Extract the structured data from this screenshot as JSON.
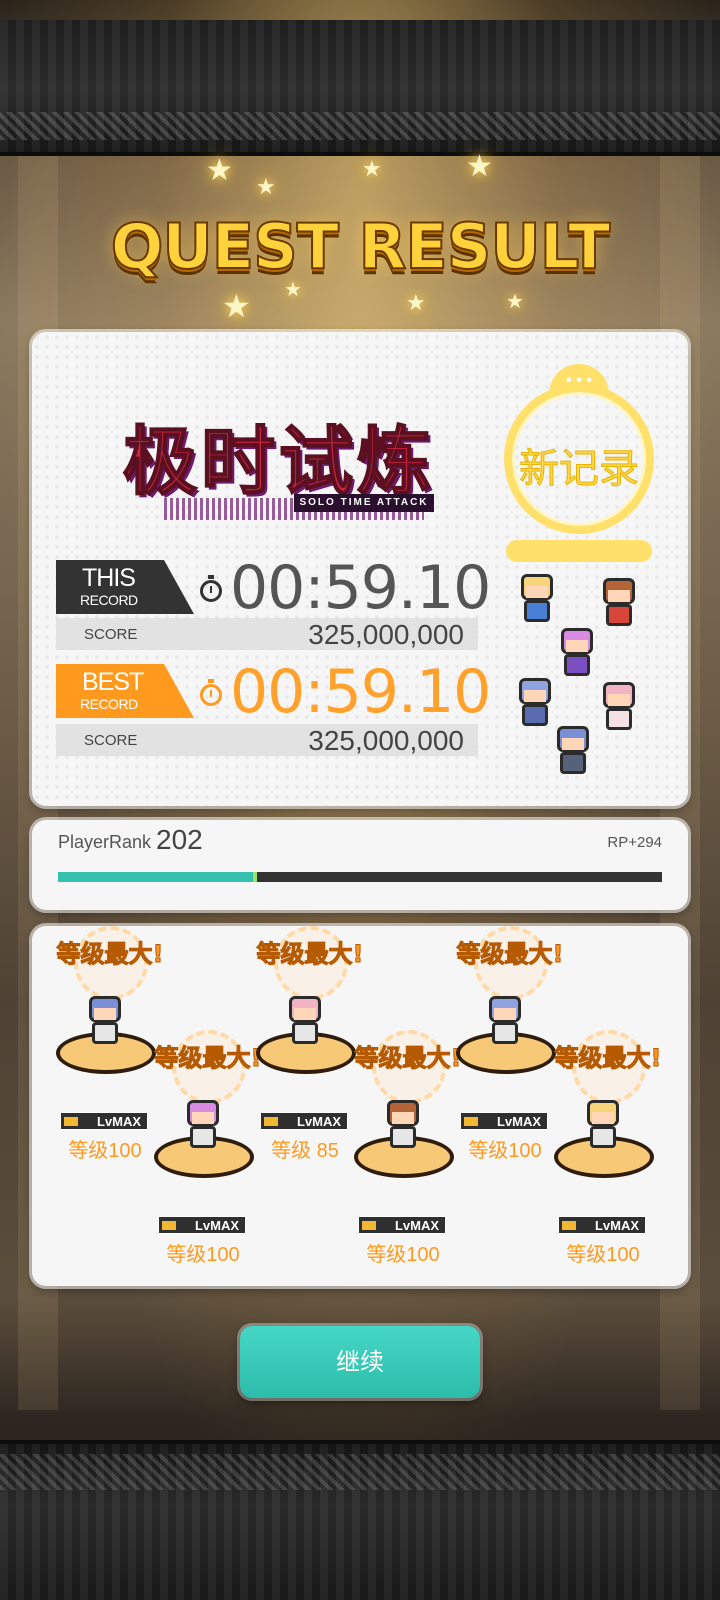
{
  "title": "QUEST RESULT",
  "event_logo": {
    "title": "极时试炼",
    "subtitle": "SOLO TIME ATTACK"
  },
  "new_record_stamp": "新记录",
  "this_record": {
    "tag_big": "THIS",
    "tag_small": "RECORD",
    "time": "00:59.10",
    "score_label": "SCORE",
    "score": "325,000,000"
  },
  "best_record": {
    "tag_big": "BEST",
    "tag_small": "RECORD",
    "time": "00:59.10",
    "score_label": "SCORE",
    "score": "325,000,000"
  },
  "player_rank": {
    "label": "PlayerRank",
    "value": "202",
    "rp": "RP+294",
    "progress": 0.33
  },
  "party": [
    {
      "max_label": "等级最大!",
      "lv_tag": "LvMAX",
      "level_text": "等级100",
      "color": "#7a8fd6"
    },
    {
      "max_label": "等级最大!",
      "lv_tag": "LvMAX",
      "level_text": "等级100",
      "color": "#d88be0"
    },
    {
      "max_label": "等级最大!",
      "lv_tag": "LvMAX",
      "level_text": "等级 85",
      "color": "#f2b4c2"
    },
    {
      "max_label": "等级最大!",
      "lv_tag": "LvMAX",
      "level_text": "等级100",
      "color": "#b5643a"
    },
    {
      "max_label": "等级最大!",
      "lv_tag": "LvMAX",
      "level_text": "等级100",
      "color": "#8fa3e0"
    },
    {
      "max_label": "等级最大!",
      "lv_tag": "LvMAX",
      "level_text": "等级100",
      "color": "#f7d37a"
    }
  ],
  "continue_label": "继续",
  "colors": {
    "accent": "#ff9a1f",
    "teal": "#34c1b0",
    "title_gold": "#ffd23b"
  }
}
